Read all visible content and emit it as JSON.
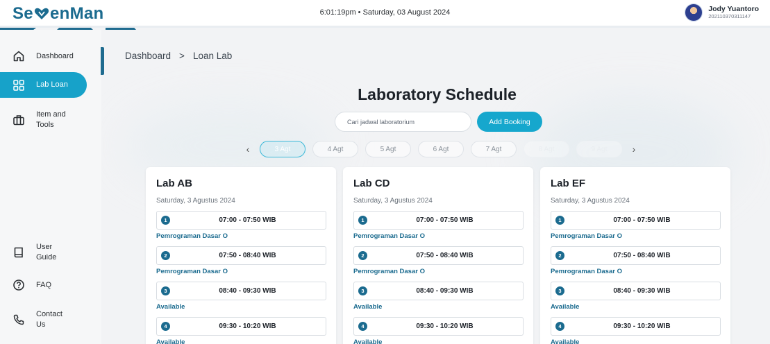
{
  "app": {
    "logo_prefix": "Se",
    "logo_suffix": "enMan"
  },
  "header": {
    "datetime": "6:01:19pm • Saturday, 03 August 2024",
    "user_name": "Jody Yuantoro",
    "user_id": "202110370311147"
  },
  "sidebar": {
    "items": [
      {
        "label": "Dashboard",
        "icon": "home-icon"
      },
      {
        "label": "Lab Loan",
        "icon": "grid-icon",
        "active": true
      },
      {
        "label": "Item and Tools",
        "icon": "toolbox-icon"
      },
      {
        "label": "User Guide",
        "icon": "book-icon"
      },
      {
        "label": "FAQ",
        "icon": "help-circle-icon"
      },
      {
        "label": "Contact Us",
        "icon": "phone-icon"
      }
    ]
  },
  "breadcrumb": {
    "root": "Dashboard",
    "separator": ">",
    "current": "Loan Lab"
  },
  "page": {
    "title": "Laboratory Schedule"
  },
  "search": {
    "placeholder": "Cari jadwal laboratorium",
    "value": ""
  },
  "add_button": {
    "label": "Add Booking"
  },
  "dates": [
    "3 Agt",
    "4 Agt",
    "5 Agt",
    "6 Agt",
    "7 Agt",
    "8 Agt",
    "9 Agt"
  ],
  "labs": [
    {
      "name": "Lab AB",
      "date": "Saturday, 3 Agustus 2024",
      "slots": [
        {
          "num": "1",
          "time": "07:00 - 07:50 WIB",
          "status": "Pemrograman Dasar O"
        },
        {
          "num": "2",
          "time": "07:50 - 08:40 WIB",
          "status": "Pemrograman Dasar O"
        },
        {
          "num": "3",
          "time": "08:40 - 09:30 WIB",
          "status": "Available"
        },
        {
          "num": "4",
          "time": "09:30 - 10:20 WIB",
          "status": "Available"
        }
      ]
    },
    {
      "name": "Lab CD",
      "date": "Saturday, 3 Agustus 2024",
      "slots": [
        {
          "num": "1",
          "time": "07:00 - 07:50 WIB",
          "status": "Pemrograman Dasar O"
        },
        {
          "num": "2",
          "time": "07:50 - 08:40 WIB",
          "status": "Pemrograman Dasar O"
        },
        {
          "num": "3",
          "time": "08:40 - 09:30 WIB",
          "status": "Available"
        },
        {
          "num": "4",
          "time": "09:30 - 10:20 WIB",
          "status": "Available"
        }
      ]
    },
    {
      "name": "Lab EF",
      "date": "Saturday, 3 Agustus 2024",
      "slots": [
        {
          "num": "1",
          "time": "07:00 - 07:50 WIB",
          "status": "Pemrograman Dasar O"
        },
        {
          "num": "2",
          "time": "07:50 - 08:40 WIB",
          "status": "Pemrograman Dasar O"
        },
        {
          "num": "3",
          "time": "08:40 - 09:30 WIB",
          "status": "Available"
        },
        {
          "num": "4",
          "time": "09:30 - 10:20 WIB",
          "status": "Available"
        }
      ]
    }
  ],
  "colors": {
    "brand": "#1b6b8f",
    "accent": "#16a7cd",
    "background": "#f2f3f5"
  }
}
